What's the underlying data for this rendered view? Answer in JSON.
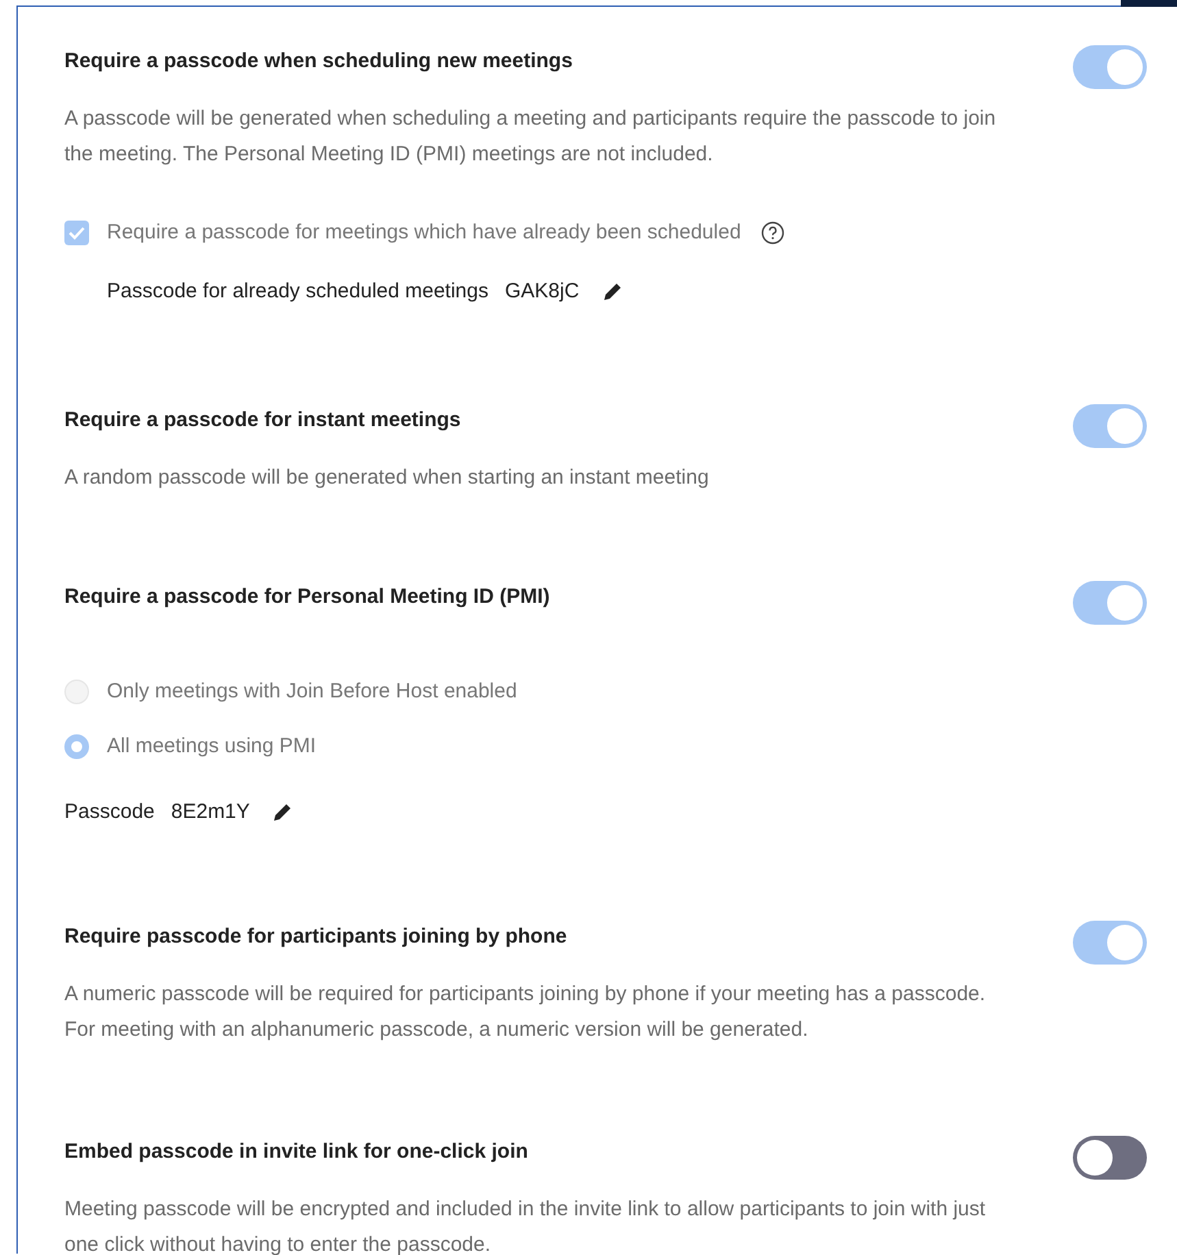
{
  "sections": [
    {
      "title": "Require a passcode when scheduling new meetings",
      "on": true,
      "description": "A passcode will be generated when scheduling a meeting and participants require the passcode to join the meeting. The Personal Meeting ID (PMI) meetings are not included.",
      "options": [
        {
          "kind": "checkbox",
          "label": "Require a passcode for meetings which have already been scheduled",
          "checked": true,
          "help": true
        },
        {
          "kind": "passcode",
          "indented": true,
          "label": "Passcode for already scheduled meetings",
          "value": "GAK8jC"
        }
      ]
    },
    {
      "title": "Require a passcode for instant meetings",
      "on": true,
      "description": "A random passcode will be generated when starting an instant meeting"
    },
    {
      "title": "Require a passcode for Personal Meeting ID (PMI)",
      "on": true,
      "options": [
        {
          "kind": "radio",
          "label": "Only meetings with Join Before Host enabled",
          "selected": false
        },
        {
          "kind": "radio",
          "label": "All meetings using PMI",
          "selected": true
        },
        {
          "kind": "passcode",
          "indented": false,
          "label": "Passcode",
          "value": "8E2m1Y"
        }
      ]
    },
    {
      "title": "Require passcode for participants joining by phone",
      "on": true,
      "description": "A numeric passcode will be required for participants joining by phone if your meeting has a passcode. For meeting with an alphanumeric passcode, a numeric version will be generated."
    },
    {
      "title": "Embed passcode in invite link for one-click join",
      "on": false,
      "description": "Meeting passcode will be encrypted and included in the invite link to allow participants to join with just one click without having to enter the passcode."
    }
  ]
}
